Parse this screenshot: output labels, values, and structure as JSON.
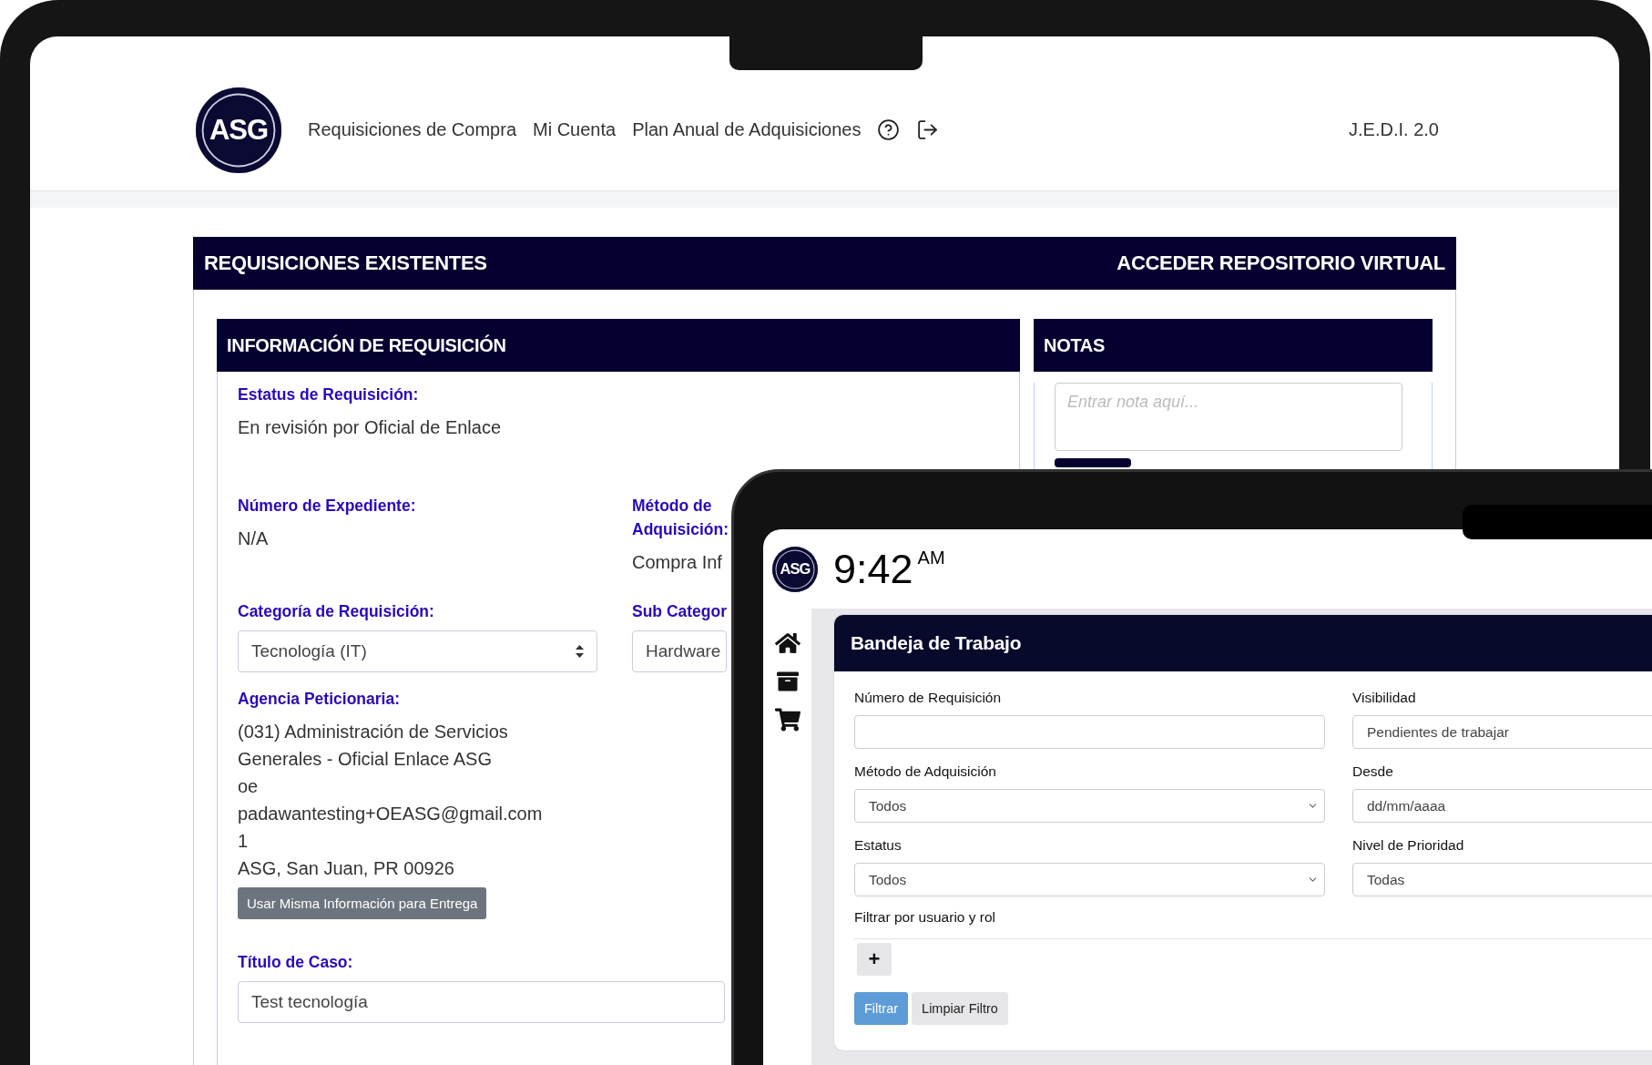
{
  "laptop": {
    "header": {
      "logo": "ASG",
      "nav": [
        "Requisiciones de Compra",
        "Mi Cuenta",
        "Plan Anual de Adquisiciones"
      ],
      "version": "J.E.D.I. 2.0"
    },
    "panel": {
      "title": "REQUISICIONES EXISTENTES",
      "link": "ACCEDER REPOSITORIO VIRTUAL"
    },
    "info": {
      "title": "INFORMACIÓN DE REQUISICIÓN",
      "status": {
        "label": "Estatus de Requisición:",
        "value": "En revisión por Oficial de Enlace"
      },
      "rows": [
        [
          {
            "kind": "text",
            "label": "Número de Expediente:",
            "value": "N/A"
          },
          {
            "kind": "text",
            "label": "Método de Adquisición:",
            "value": "Compra Inf"
          }
        ],
        [
          {
            "kind": "select",
            "label": "Categoría de Requisición:",
            "value": "Tecnología (IT)"
          },
          {
            "kind": "select",
            "label": "Sub Categor",
            "value": "Hardware"
          }
        ]
      ],
      "agency": {
        "label": "Agencia Peticionaria:",
        "lines": [
          "(031) Administración de Servicios",
          "Generales - Oficial Enlace ASG",
          "oe",
          "padawantesting+OEASG@gmail.com",
          "1",
          "ASG, San Juan, PR 00926"
        ],
        "button": "Usar Misma Información para Entrega"
      },
      "case_title": {
        "label": "Título de Caso:",
        "value": "Test tecnología"
      }
    },
    "notes": {
      "title": "NOTAS",
      "placeholder": "Entrar nota aquí..."
    }
  },
  "tablet": {
    "logo": "ASG",
    "time": "9:42",
    "ampm": "AM",
    "card": {
      "title": "Bandeja de Trabajo",
      "fields": [
        {
          "kind": "input",
          "label": "Número de Requisición"
        },
        {
          "kind": "select",
          "label": "Visibilidad",
          "value": "Pendientes de trabajar"
        },
        {
          "kind": "select",
          "label": "Método de Adquisición",
          "value": "Todos"
        },
        {
          "kind": "date",
          "label": "Desde",
          "placeholder": "dd/mm/aaaa"
        },
        {
          "kind": "select",
          "label": "Estatus",
          "value": "Todos"
        },
        {
          "kind": "select",
          "label": "Nivel de Prioridad",
          "value": "Todas"
        }
      ],
      "user_filter": {
        "label": "Filtrar por usuario y rol",
        "add": "+"
      },
      "buttons": [
        {
          "kind": "primary",
          "label": "Filtrar"
        },
        {
          "kind": "secondary",
          "label": "Limpiar Filtro"
        }
      ]
    }
  }
}
